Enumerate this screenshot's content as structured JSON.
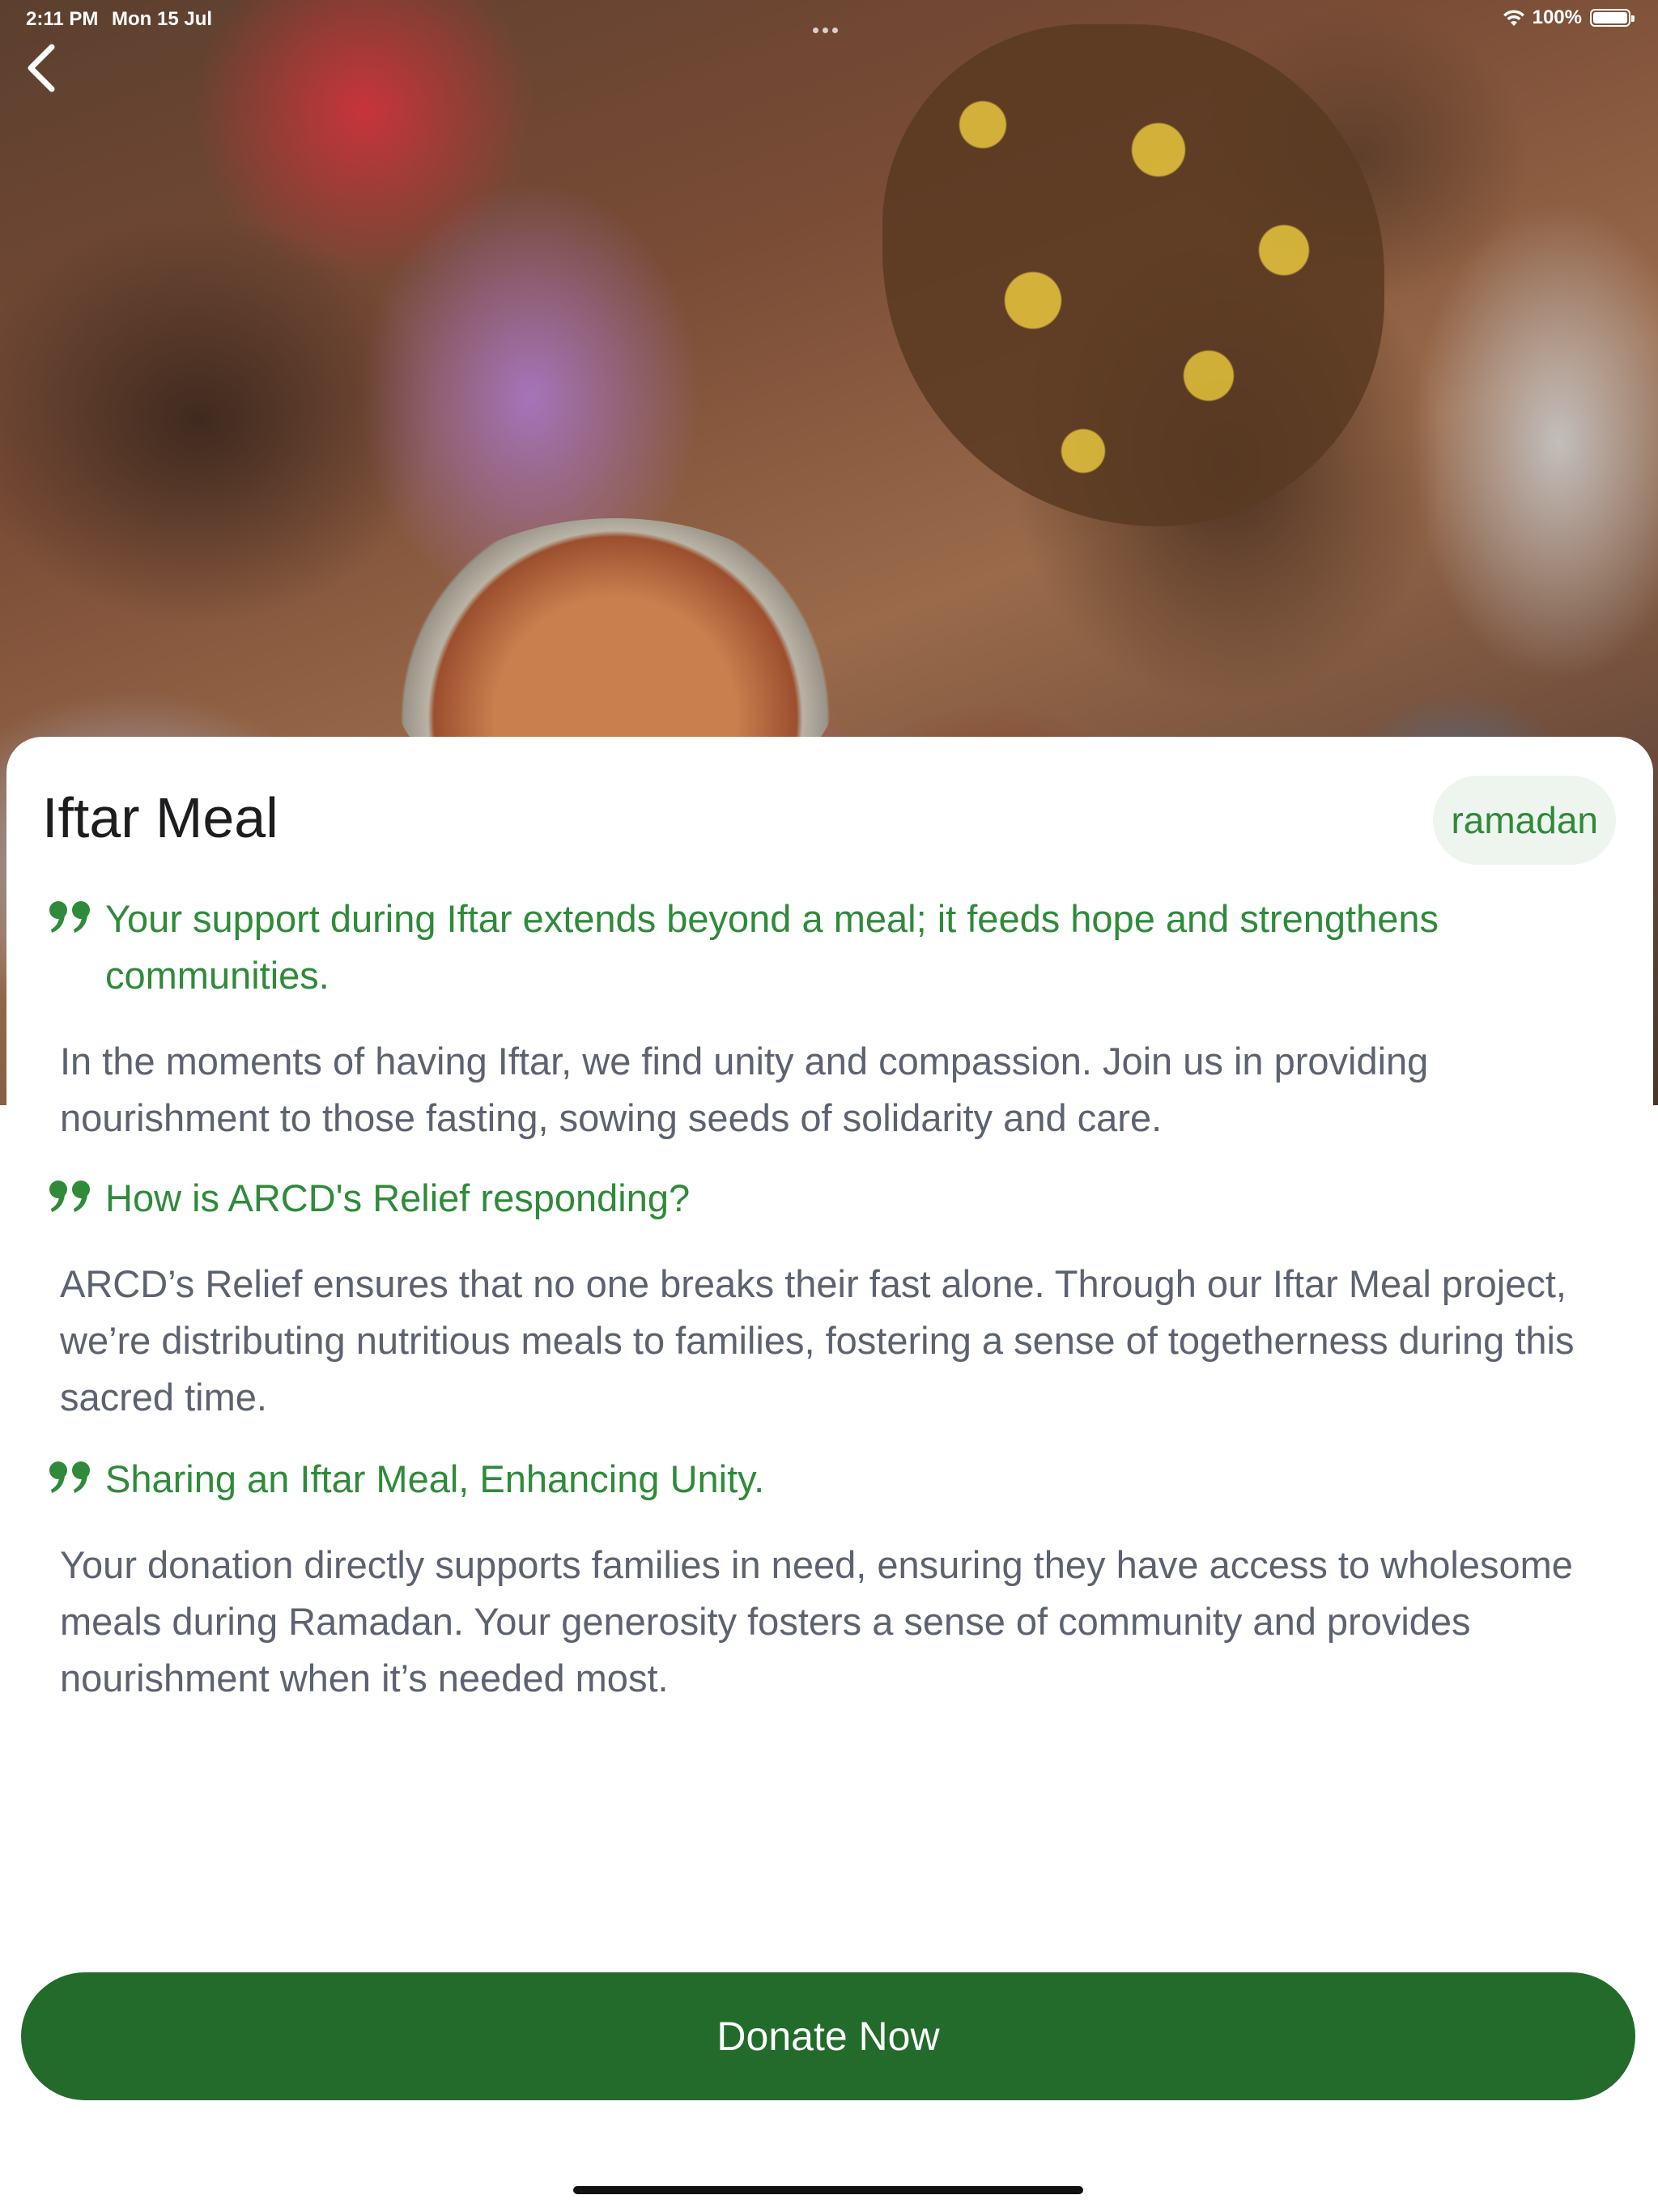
{
  "status_bar": {
    "time": "2:11 PM",
    "date": "Mon 15 Jul",
    "battery": "100%",
    "icons": [
      "wifi-icon",
      "battery-icon"
    ]
  },
  "nav": {
    "back_icon": "chevron-left-icon"
  },
  "campaign": {
    "title": "Iftar Meal",
    "tag": "ramadan",
    "sections": [
      {
        "quote": "Your support during Iftar extends beyond a meal; it feeds hope and strengthens communities.",
        "body": "In the moments of having Iftar, we find unity and compassion. Join us in providing nourishment to those fasting, sowing seeds of solidarity and care."
      },
      {
        "quote": "How is ARCD's Relief responding?",
        "body": "ARCD’s Relief ensures that no one breaks their fast alone. Through our Iftar Meal project, we’re distributing nutritious meals to families, fostering a sense of togetherness during this sacred time."
      },
      {
        "quote": "Sharing an Iftar Meal, Enhancing Unity.",
        "body": "Your donation directly supports families in need, ensuring they have access to wholesome meals during Ramadan. Your generosity fosters a sense of community and provides nourishment when it’s needed most."
      }
    ]
  },
  "actions": {
    "donate_label": "Donate Now"
  },
  "colors": {
    "accent_green": "#2f8a3a",
    "button_green": "#226b2b",
    "tag_background": "#eef5ee",
    "body_text": "#5d6270"
  }
}
